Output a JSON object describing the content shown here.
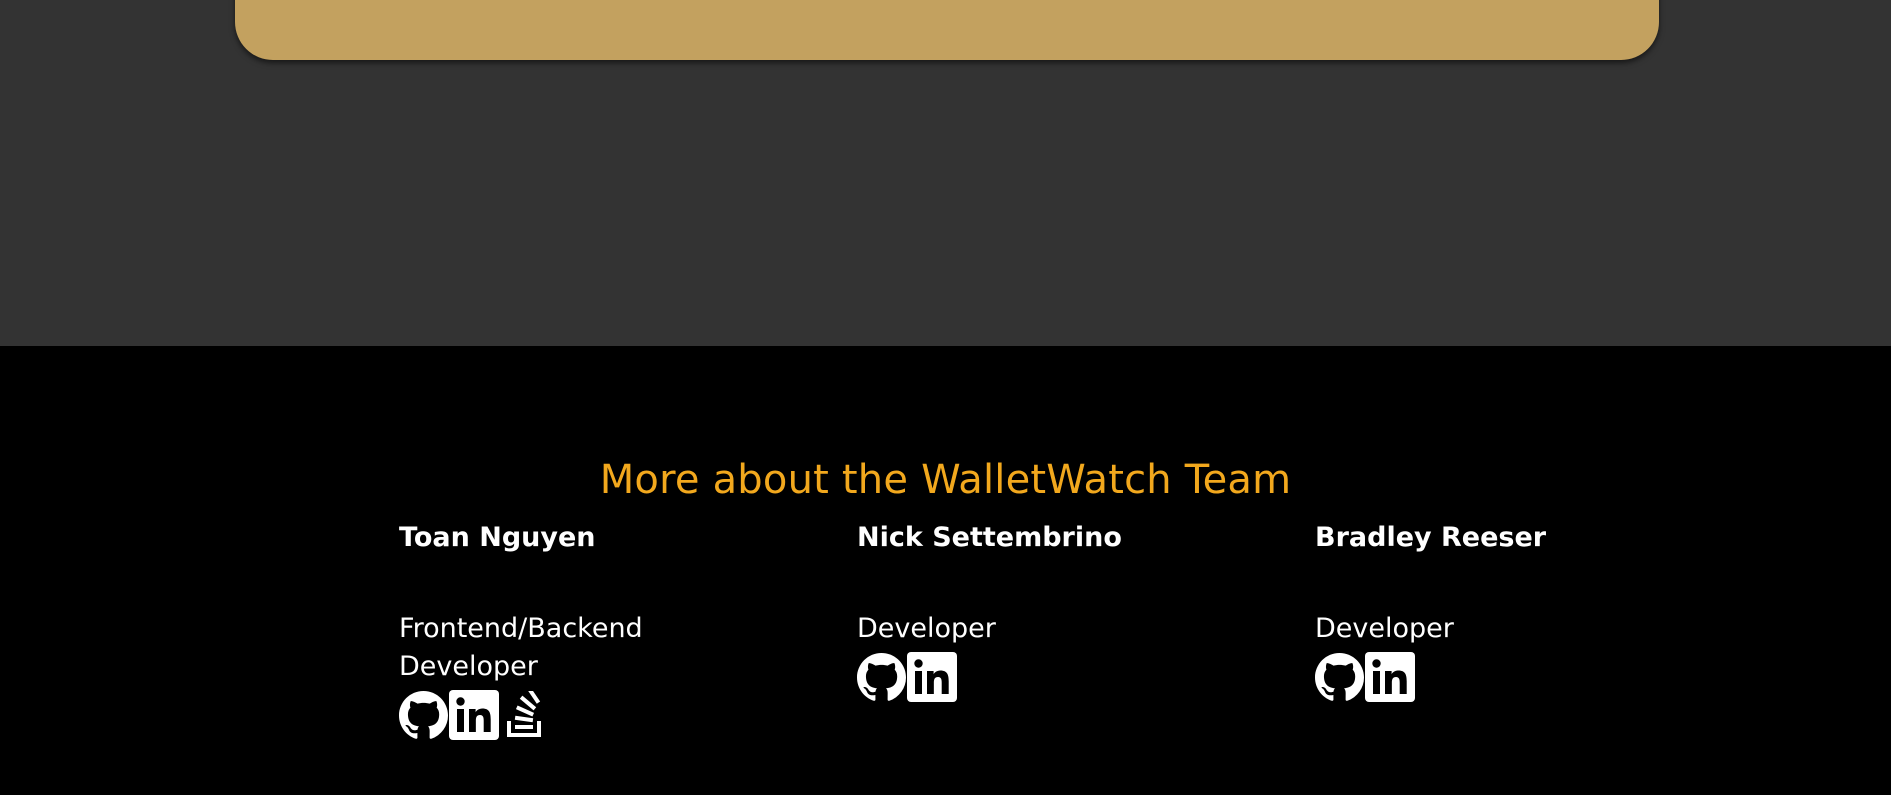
{
  "footer": {
    "title": "More about the WalletWatch Team",
    "members": [
      {
        "name": "Toan Nguyen",
        "role": "Frontend/Backend Developer",
        "links": [
          "github-icon",
          "linkedin-icon",
          "stackoverflow-icon"
        ]
      },
      {
        "name": "Nick Settembrino",
        "role": "Developer",
        "links": [
          "github-icon",
          "linkedin-icon"
        ]
      },
      {
        "name": "Bradley Reeser",
        "role": "Developer",
        "links": [
          "github-icon",
          "linkedin-icon"
        ]
      }
    ]
  },
  "colors": {
    "background_upper": "#333333",
    "card": "#c3a15f",
    "footer_background": "#000000",
    "accent_title": "#f2a81d",
    "text": "#ffffff"
  }
}
